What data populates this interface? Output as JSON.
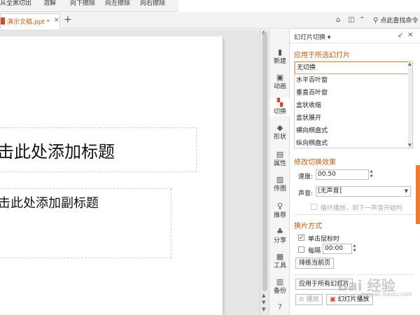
{
  "ribbon": {
    "buttons": [
      "从全黑切出",
      "溶解",
      "向下擦除",
      "向左擦除",
      "向右擦除"
    ]
  },
  "tabbar": {
    "doc_tab": "演示文稿.ppt *",
    "doc_close": "×",
    "new_tab": "+",
    "search_label": "点此查找命令"
  },
  "slide": {
    "title_placeholder": "击此处添加标题",
    "subtitle_placeholder": "击此处添加副标题"
  },
  "rail": {
    "items": [
      {
        "label": "新建",
        "icon": "new-icon",
        "glyph": "▮"
      },
      {
        "label": "动画",
        "icon": "animation-icon",
        "glyph": "▣"
      },
      {
        "label": "切换",
        "icon": "transition-icon",
        "glyph": "▚"
      },
      {
        "label": "形状",
        "icon": "shape-icon",
        "glyph": "◆"
      },
      {
        "label": "属性",
        "icon": "properties-icon",
        "glyph": "▤"
      },
      {
        "label": "传图",
        "icon": "upload-image-icon",
        "glyph": "▨"
      },
      {
        "label": "推荐",
        "icon": "bulb-icon",
        "glyph": "♀"
      },
      {
        "label": "分享",
        "icon": "share-icon",
        "glyph": "♣"
      },
      {
        "label": "工具",
        "icon": "toolbox-icon",
        "glyph": "▦"
      },
      {
        "label": "备份",
        "icon": "backup-icon",
        "glyph": "▥"
      }
    ],
    "help_glyph": "?"
  },
  "pane": {
    "title": "幻灯片切换",
    "title_caret": "▾",
    "apply_heading": "应用于所选幻灯片",
    "transitions": [
      "无切换",
      "水平百叶窗",
      "垂直百叶窗",
      "盒状收缩",
      "盒状展开",
      "横向棋盘式",
      "纵向棋盘式"
    ],
    "modify_heading": "修改切换效果",
    "speed_label": "速度:",
    "speed_value": "00.50",
    "sound_label": "声音:",
    "sound_value": "[无声音]",
    "loop_label": "循环播放，到下一声音开始时",
    "advance_heading": "换片方式",
    "on_click_label": "单击鼠标时",
    "on_click_checked": "✓",
    "every_label": "每隔",
    "every_value": "00:00",
    "rehearse_button": "排练当前页",
    "apply_all_button": "应用于所有幻灯片",
    "play_button": "播放",
    "slideshow_button": "幻灯片播放"
  },
  "watermark": {
    "text": "Bai 经验",
    "sub": "jingyan.baidu.com"
  },
  "colors": {
    "accent": "#c55a11",
    "active_icon": "#d24726",
    "scroll_indicator": "#f07a2d"
  }
}
